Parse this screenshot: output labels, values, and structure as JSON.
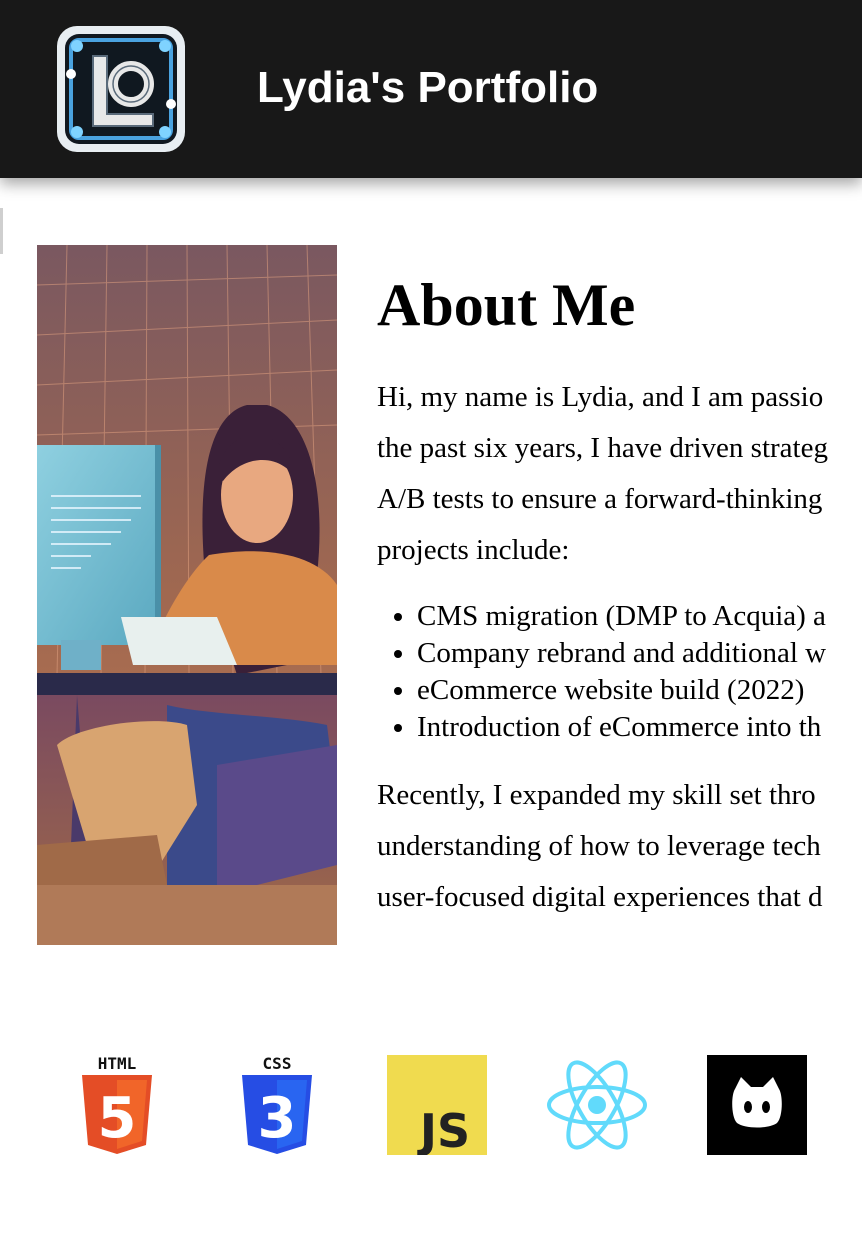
{
  "header": {
    "site_title": "Lydia's Portfolio",
    "logo_letters": "LO"
  },
  "about": {
    "heading": "About Me",
    "intro_lines": [
      "Hi, my name is Lydia, and I am passio",
      "the past six years, I have driven strateg",
      "A/B tests to ensure a forward-thinking",
      "projects include:"
    ],
    "projects": [
      "CMS migration (DMP to Acquia) a",
      "Company rebrand and additional w",
      "eCommerce website build (2022)",
      "Introduction of eCommerce into th"
    ],
    "closing_lines": [
      "Recently, I expanded my skill set thro",
      "understanding of how to leverage tech",
      "user-focused digital experiences that d"
    ]
  },
  "skills": [
    {
      "name": "html5-icon",
      "label": "HTML",
      "numeral": "5",
      "color": "#e44d26"
    },
    {
      "name": "css3-icon",
      "label": "CSS",
      "numeral": "3",
      "color": "#264de4"
    },
    {
      "name": "javascript-icon",
      "label": "JS",
      "color": "#f0db4f"
    },
    {
      "name": "react-icon",
      "color": "#61dafb"
    },
    {
      "name": "github-icon",
      "color": "#000000"
    }
  ],
  "colors": {
    "header_bg": "#181818",
    "header_text": "#ffffff"
  }
}
